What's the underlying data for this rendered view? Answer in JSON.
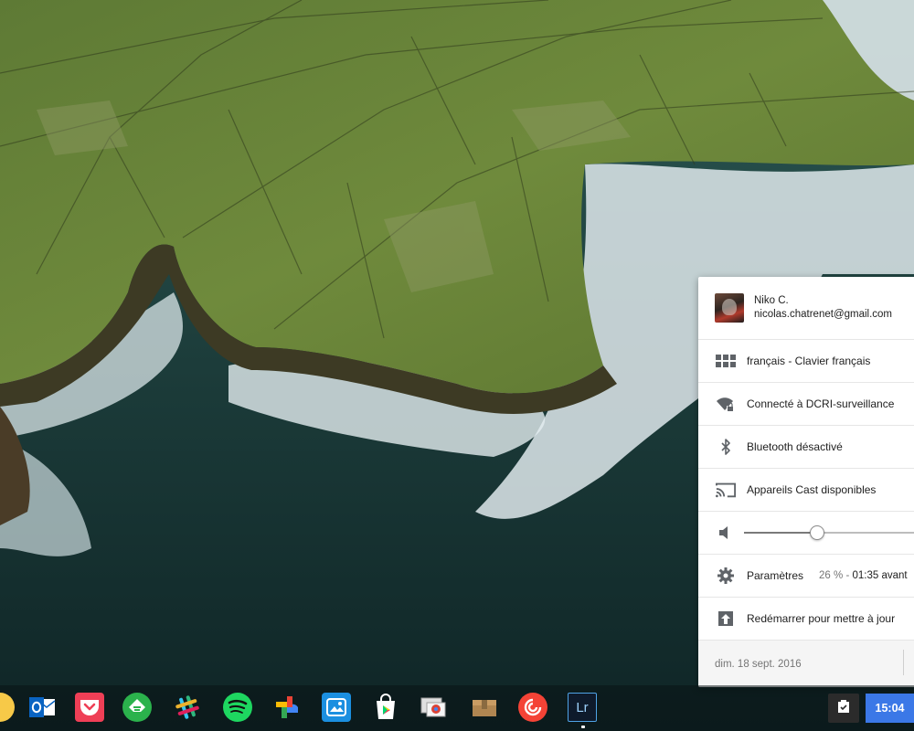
{
  "tray": {
    "user": {
      "name": "Niko C.",
      "email": "nicolas.chatrenet@gmail.com"
    },
    "keyboard": {
      "label": "français - Clavier français",
      "icon": "keyboard-icon"
    },
    "network": {
      "label": "Connecté à DCRI-surveillance",
      "icon": "wifi-lock-icon"
    },
    "bluetooth": {
      "label": "Bluetooth désactivé",
      "icon": "bluetooth-icon"
    },
    "cast": {
      "label": "Appareils Cast disponibles",
      "icon": "cast-icon"
    },
    "volume": {
      "icon": "volume-icon",
      "level_fraction": 0.4
    },
    "settings": {
      "label": "Paramètres",
      "battery": "26 %",
      "sep": " - ",
      "time_left": "01:35 avant"
    },
    "restart": {
      "label": "Redémarrer pour mettre à jour",
      "icon": "update-icon"
    },
    "date": "dim. 18 sept. 2016"
  },
  "shelf": {
    "apps": [
      {
        "name": "partial-app",
        "icon": "chrome-partial-icon"
      },
      {
        "name": "outlook",
        "icon": "outlook-icon"
      },
      {
        "name": "pocket",
        "icon": "pocket-icon"
      },
      {
        "name": "feedly",
        "icon": "feedly-icon"
      },
      {
        "name": "slack",
        "icon": "slack-icon"
      },
      {
        "name": "spotify",
        "icon": "spotify-icon"
      },
      {
        "name": "google-photos",
        "icon": "google-photos-icon"
      },
      {
        "name": "image-app",
        "icon": "image-app-icon"
      },
      {
        "name": "play-store",
        "icon": "play-store-icon"
      },
      {
        "name": "chrome-remote",
        "icon": "chrome-remote-icon"
      },
      {
        "name": "archive",
        "icon": "archive-icon"
      },
      {
        "name": "pocket-casts",
        "icon": "pocket-casts-icon"
      },
      {
        "name": "lightroom",
        "icon": "lightroom-icon",
        "text": "Lr"
      }
    ],
    "clock": "15:04"
  },
  "colors": {
    "accent": "#3b78e7",
    "tray_bg": "#ffffff",
    "footer_bg": "#f5f5f5"
  }
}
